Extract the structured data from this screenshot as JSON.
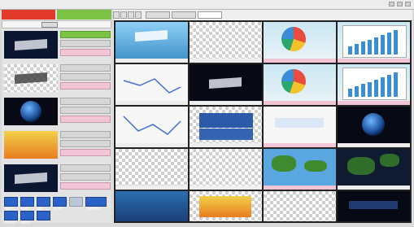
{
  "window": {
    "title": ""
  },
  "left": {
    "header": {
      "red_label": "",
      "green_label": ""
    },
    "subbar": {
      "button_label": ""
    },
    "items": [
      {
        "title": "",
        "time": "",
        "duration": ""
      },
      {
        "title": "",
        "time": "",
        "duration": ""
      },
      {
        "title": "",
        "time": "",
        "duration": ""
      },
      {
        "title": "",
        "time": "",
        "duration": ""
      },
      {
        "title": "",
        "time": "",
        "duration": ""
      }
    ],
    "controls": [
      {
        "label": "SKIP"
      },
      {
        "label": "BACK"
      },
      {
        "label": "INF"
      },
      {
        "label": "STOP"
      },
      {
        "label": ""
      },
      {
        "label": "CHANGE"
      },
      {
        "label": "CLEAR"
      },
      {
        "label": "INPUT"
      },
      {
        "label": ""
      }
    ]
  },
  "right": {
    "tabs": [
      {
        "label": ""
      },
      {
        "label": ""
      },
      {
        "label": ""
      }
    ],
    "tiles": [
      {
        "kind": "title-card",
        "label": ""
      },
      {
        "kind": "empty",
        "label": ""
      },
      {
        "kind": "pie-chart",
        "label": ""
      },
      {
        "kind": "bar-chart",
        "label": ""
      },
      {
        "kind": "line-chart",
        "label": ""
      },
      {
        "kind": "logo-dark",
        "label": ""
      },
      {
        "kind": "pie-chart",
        "label": ""
      },
      {
        "kind": "bar-chart",
        "label": ""
      },
      {
        "kind": "line-chart",
        "label": ""
      },
      {
        "kind": "clock",
        "label": ""
      },
      {
        "kind": "graphic",
        "label": ""
      },
      {
        "kind": "globe",
        "label": ""
      },
      {
        "kind": "empty",
        "label": ""
      },
      {
        "kind": "empty",
        "label": ""
      },
      {
        "kind": "map",
        "label": ""
      },
      {
        "kind": "map-dark",
        "label": ""
      },
      {
        "kind": "underwater",
        "label": ""
      },
      {
        "kind": "sat-card",
        "label": ""
      },
      {
        "kind": "empty",
        "label": ""
      },
      {
        "kind": "dark-card",
        "label": ""
      }
    ]
  },
  "colors": {
    "accent_red": "#e23a2a",
    "accent_green": "#7cc244",
    "button_blue": "#2a62c8",
    "label_pink": "#f2c5d6"
  }
}
